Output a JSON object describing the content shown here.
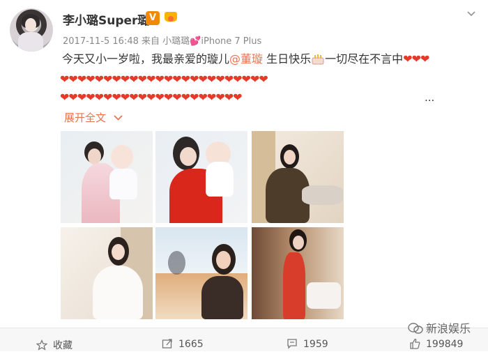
{
  "post": {
    "username": "李小璐Super璐",
    "vip_badge": "V",
    "meta": {
      "date": "2017-11-5 16:48",
      "from_label": "来自",
      "source": "小璐璐",
      "device": "iPhone 7 Plus"
    },
    "content": {
      "prefix": "今天又小一岁啦，我最亲爱的璇儿",
      "mention": "@董璇",
      "birthday": "生日快乐",
      "cake_icon": "birthday-cake-icon",
      "suffix": "一切尽在不言中",
      "ellipsis": "..."
    },
    "expand_label": "展开全文",
    "heart_emoji": "❤",
    "photos": [
      {
        "id": 1,
        "desc_icon": "mother-child-photo"
      },
      {
        "id": 2,
        "desc_icon": "mother-child-photo"
      },
      {
        "id": 3,
        "desc_icon": "seated-woman-photo"
      },
      {
        "id": 4,
        "desc_icon": "woman-sweater-photo"
      },
      {
        "id": 5,
        "desc_icon": "window-reflection-photo"
      },
      {
        "id": 6,
        "desc_icon": "red-dress-photo"
      }
    ]
  },
  "footer": {
    "favorite_label": "收藏",
    "repost_count": "1665",
    "comment_count": "1959",
    "like_count": "199849"
  },
  "watermark": "新浪娱乐",
  "colors": {
    "link": "#eb7350",
    "heart": "#e5392a",
    "vip": "#f08a00"
  }
}
